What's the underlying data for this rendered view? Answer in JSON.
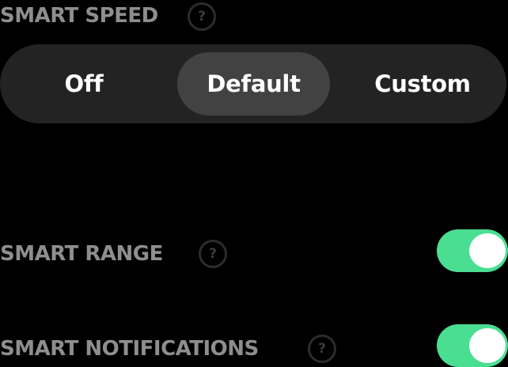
{
  "smart_speed": {
    "title": "SMART SPEED",
    "help_glyph": "?",
    "options": [
      {
        "label": "Off",
        "selected": false
      },
      {
        "label": "Default",
        "selected": true
      },
      {
        "label": "Custom",
        "selected": false
      }
    ]
  },
  "smart_range": {
    "title": "SMART RANGE",
    "help_glyph": "?",
    "enabled": true
  },
  "smart_notifications": {
    "title": "SMART NOTIFICATIONS",
    "help_glyph": "?",
    "enabled": true
  },
  "icons": {
    "help": "question-circle-icon"
  },
  "colors": {
    "background": "#000000",
    "title_text": "#8e8e8e",
    "segment_track": "#232323",
    "segment_selected": "#424242",
    "toggle_on": "#4ade92",
    "toggle_knob": "#ffffff"
  }
}
